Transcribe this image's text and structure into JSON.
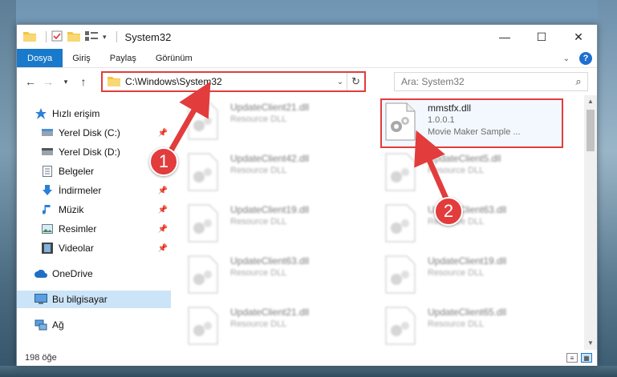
{
  "window": {
    "title": "System32",
    "controls": {
      "minimize": "—",
      "maximize": "☐",
      "close": "✕"
    }
  },
  "ribbon": {
    "tabs": [
      {
        "label": "Dosya",
        "active": true
      },
      {
        "label": "Giriş"
      },
      {
        "label": "Paylaş"
      },
      {
        "label": "Görünüm"
      }
    ],
    "help": "?"
  },
  "address": {
    "path": "C:\\Windows\\System32",
    "search_placeholder": "Ara: System32"
  },
  "nav": {
    "items": [
      {
        "label": "Hızlı erişim",
        "icon": "star-icon"
      },
      {
        "label": "Yerel Disk (C:)",
        "icon": "drive-icon",
        "pinned": true
      },
      {
        "label": "Yerel Disk (D:)",
        "icon": "drive-icon",
        "pinned": true
      },
      {
        "label": "Belgeler",
        "icon": "documents-icon",
        "pinned": true
      },
      {
        "label": "İndirmeler",
        "icon": "download-icon",
        "pinned": true
      },
      {
        "label": "Müzik",
        "icon": "music-icon",
        "pinned": true
      },
      {
        "label": "Resimler",
        "icon": "pictures-icon",
        "pinned": true
      },
      {
        "label": "Videolar",
        "icon": "videos-icon",
        "pinned": true
      },
      {
        "label": "OneDrive",
        "icon": "cloud-icon"
      },
      {
        "label": "Bu bilgisayar",
        "icon": "computer-icon",
        "selected": true
      },
      {
        "label": "Ağ",
        "icon": "network-icon"
      }
    ]
  },
  "files": [
    {
      "name": "UpdateClient21.dll",
      "sub": "Resource DLL"
    },
    {
      "name": "mmstfx.dll",
      "sub": "1.0.0.1",
      "sub2": "Movie Maker Sample ...",
      "highlight": true
    },
    {
      "name": "UpdateClient42.dll",
      "sub": "Resource DLL"
    },
    {
      "name": "UpdateClient5.dll",
      "sub": "Resource DLL"
    },
    {
      "name": "UpdateClient19.dll",
      "sub": "Resource DLL"
    },
    {
      "name": "UpdateClient63.dll",
      "sub": "Resource DLL"
    },
    {
      "name": "UpdateClient63.dll",
      "sub": "Resource DLL"
    },
    {
      "name": "UpdateClient19.dll",
      "sub": "Resource DLL"
    },
    {
      "name": "UpdateClient21.dll",
      "sub": "Resource DLL"
    },
    {
      "name": "UpdateClient65.dll",
      "sub": "Resource DLL"
    }
  ],
  "status": {
    "count": "198 öğe"
  },
  "callouts": [
    "1",
    "2"
  ],
  "colors": {
    "accent": "#1979ca",
    "highlight": "#e23c3c",
    "selected": "#cce4f7"
  }
}
